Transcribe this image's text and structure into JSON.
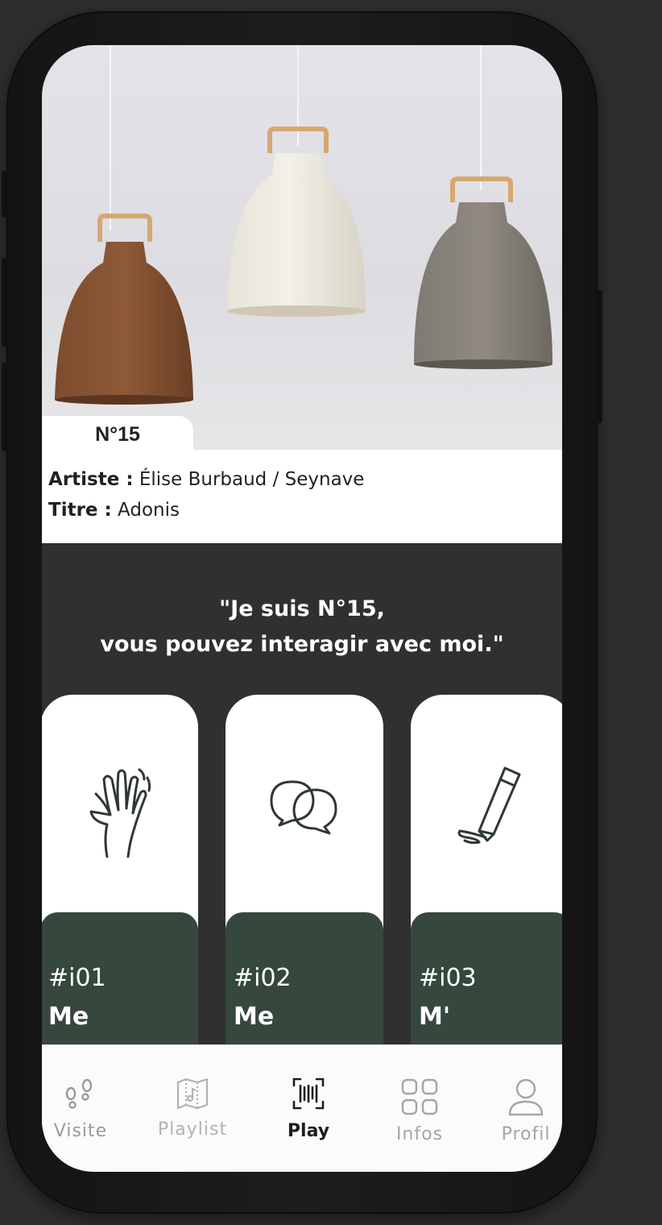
{
  "artwork": {
    "number": "N°15",
    "artist_label": "Artiste :",
    "artist_value": "Élise Burbaud / Seynave",
    "title_label": "Titre :",
    "title_value": "Adonis"
  },
  "quote": {
    "line1": "\"Je suis N°15,",
    "line2": "vous pouvez interagir avec moi.\""
  },
  "interactions": [
    {
      "code": "#i01",
      "title": "Me",
      "icon": "waving-hand-icon"
    },
    {
      "code": "#i02",
      "title": "Me",
      "icon": "chat-bubbles-icon"
    },
    {
      "code": "#i03",
      "title": "M'",
      "icon": "pencil-icon"
    }
  ],
  "tabs": [
    {
      "label": "Visite",
      "icon": "footsteps-icon",
      "active": false
    },
    {
      "label": "Playlist",
      "icon": "music-map-icon",
      "active": false
    },
    {
      "label": "Play",
      "icon": "barcode-scan-icon",
      "active": true
    },
    {
      "label": "Infos",
      "icon": "grid-icon",
      "active": false
    },
    {
      "label": "Profil",
      "icon": "user-icon",
      "active": false
    }
  ],
  "colors": {
    "background": "#303030",
    "card_accent": "#36473d",
    "tab_inactive": "#9a9a9a",
    "tab_active": "#1e1e1e"
  }
}
